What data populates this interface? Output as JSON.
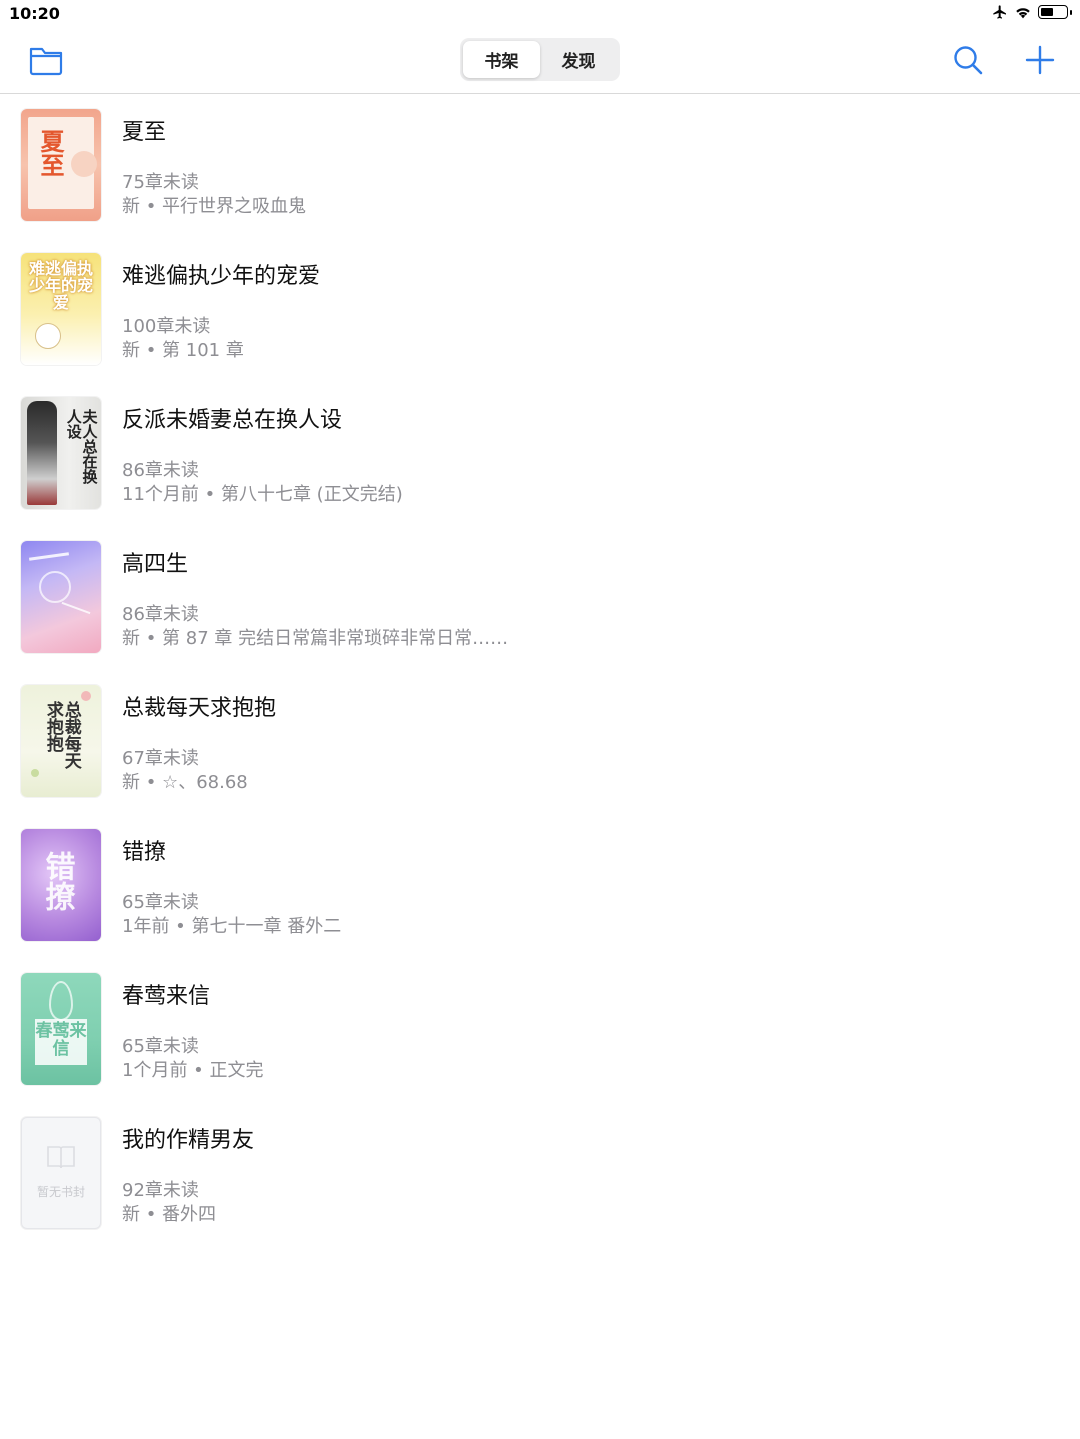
{
  "status_bar": {
    "time": "10:20"
  },
  "nav": {
    "tabs": [
      {
        "label": "书架",
        "active": true
      },
      {
        "label": "发现",
        "active": false
      }
    ],
    "accent_color": "#2f7ce8"
  },
  "books": [
    {
      "title": "夏至",
      "unread": "75章未读",
      "latest": "新 • 平行世界之吸血鬼",
      "cover_text": "夏至",
      "cover_color": "#f0a088"
    },
    {
      "title": "难逃偏执少年的宠爱",
      "unread": "100章未读",
      "latest": "新 • 第 101 章",
      "cover_text": "难逃偏执少年的宠爱",
      "cover_color": "#f6e27a"
    },
    {
      "title": "反派未婚妻总在换人设",
      "unread": "86章未读",
      "latest": "11个月前 • 第八十七章 (正文完结)",
      "cover_text": "夫人总在换人设",
      "cover_color": "#e6e6e3"
    },
    {
      "title": "高四生",
      "unread": "86章未读",
      "latest": "新 • 第 87 章 完结日常篇非常琐碎非常日常……",
      "cover_text": "",
      "cover_color": "#c9c2f2"
    },
    {
      "title": "总裁每天求抱抱",
      "unread": "67章未读",
      "latest": "新 • ☆、68.68",
      "cover_text": "总裁每天求抱抱",
      "cover_color": "#eef2dc"
    },
    {
      "title": "错撩",
      "unread": "65章未读",
      "latest": "1年前 • 第七十一章 番外二",
      "cover_text": "错撩",
      "cover_color": "#b88ae0"
    },
    {
      "title": "春莺来信",
      "unread": "65章未读",
      "latest": "1个月前 • 正文完",
      "cover_text": "春莺来信",
      "cover_color": "#7fcfb0"
    },
    {
      "title": "我的作精男友",
      "unread": "92章未读",
      "latest": "新 • 番外四",
      "cover_text": "暂无书封",
      "cover_color": "#f5f6f8"
    }
  ]
}
